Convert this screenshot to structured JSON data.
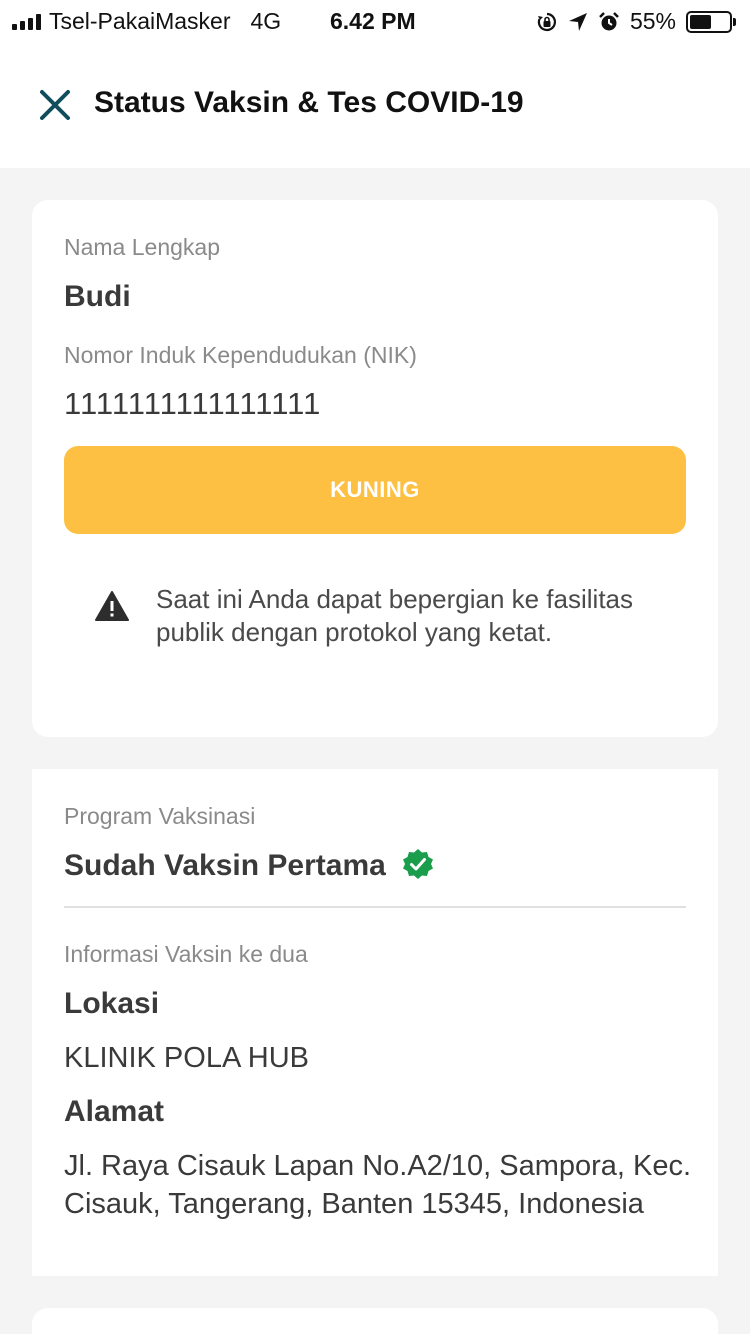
{
  "status_bar": {
    "carrier": "Tsel-PakaiMasker",
    "network": "4G",
    "time": "6.42 PM",
    "battery": "55%",
    "battery_level": 0.55
  },
  "header": {
    "title": "Status Vaksin & Tes COVID-19",
    "close_icon": "close-icon"
  },
  "identity": {
    "name_label": "Nama Lengkap",
    "name": "Budi",
    "nik_label": "Nomor Induk Kependudukan (NIK)",
    "nik": "1111111111111111",
    "status_label": "KUNING",
    "status_color": "#fdc043",
    "warning_icon": "warning-icon",
    "warning_text": "Saat ini Anda dapat bepergian ke fasilitas publik dengan protokol yang ketat."
  },
  "vaccine": {
    "program_label": "Program Vaksinasi",
    "program_status": "Sudah Vaksin Pertama",
    "verified_icon": "verified-badge-icon",
    "verified_color": "#1a9e4b",
    "info_label": "Informasi Vaksin ke dua",
    "location_label": "Lokasi",
    "location": "KLINIK POLA HUB",
    "address_label": "Alamat",
    "address": "Jl. Raya Cisauk Lapan No.A2/10, Sampora, Kec. Cisauk, Tangerang, Banten 15345, Indonesia"
  }
}
